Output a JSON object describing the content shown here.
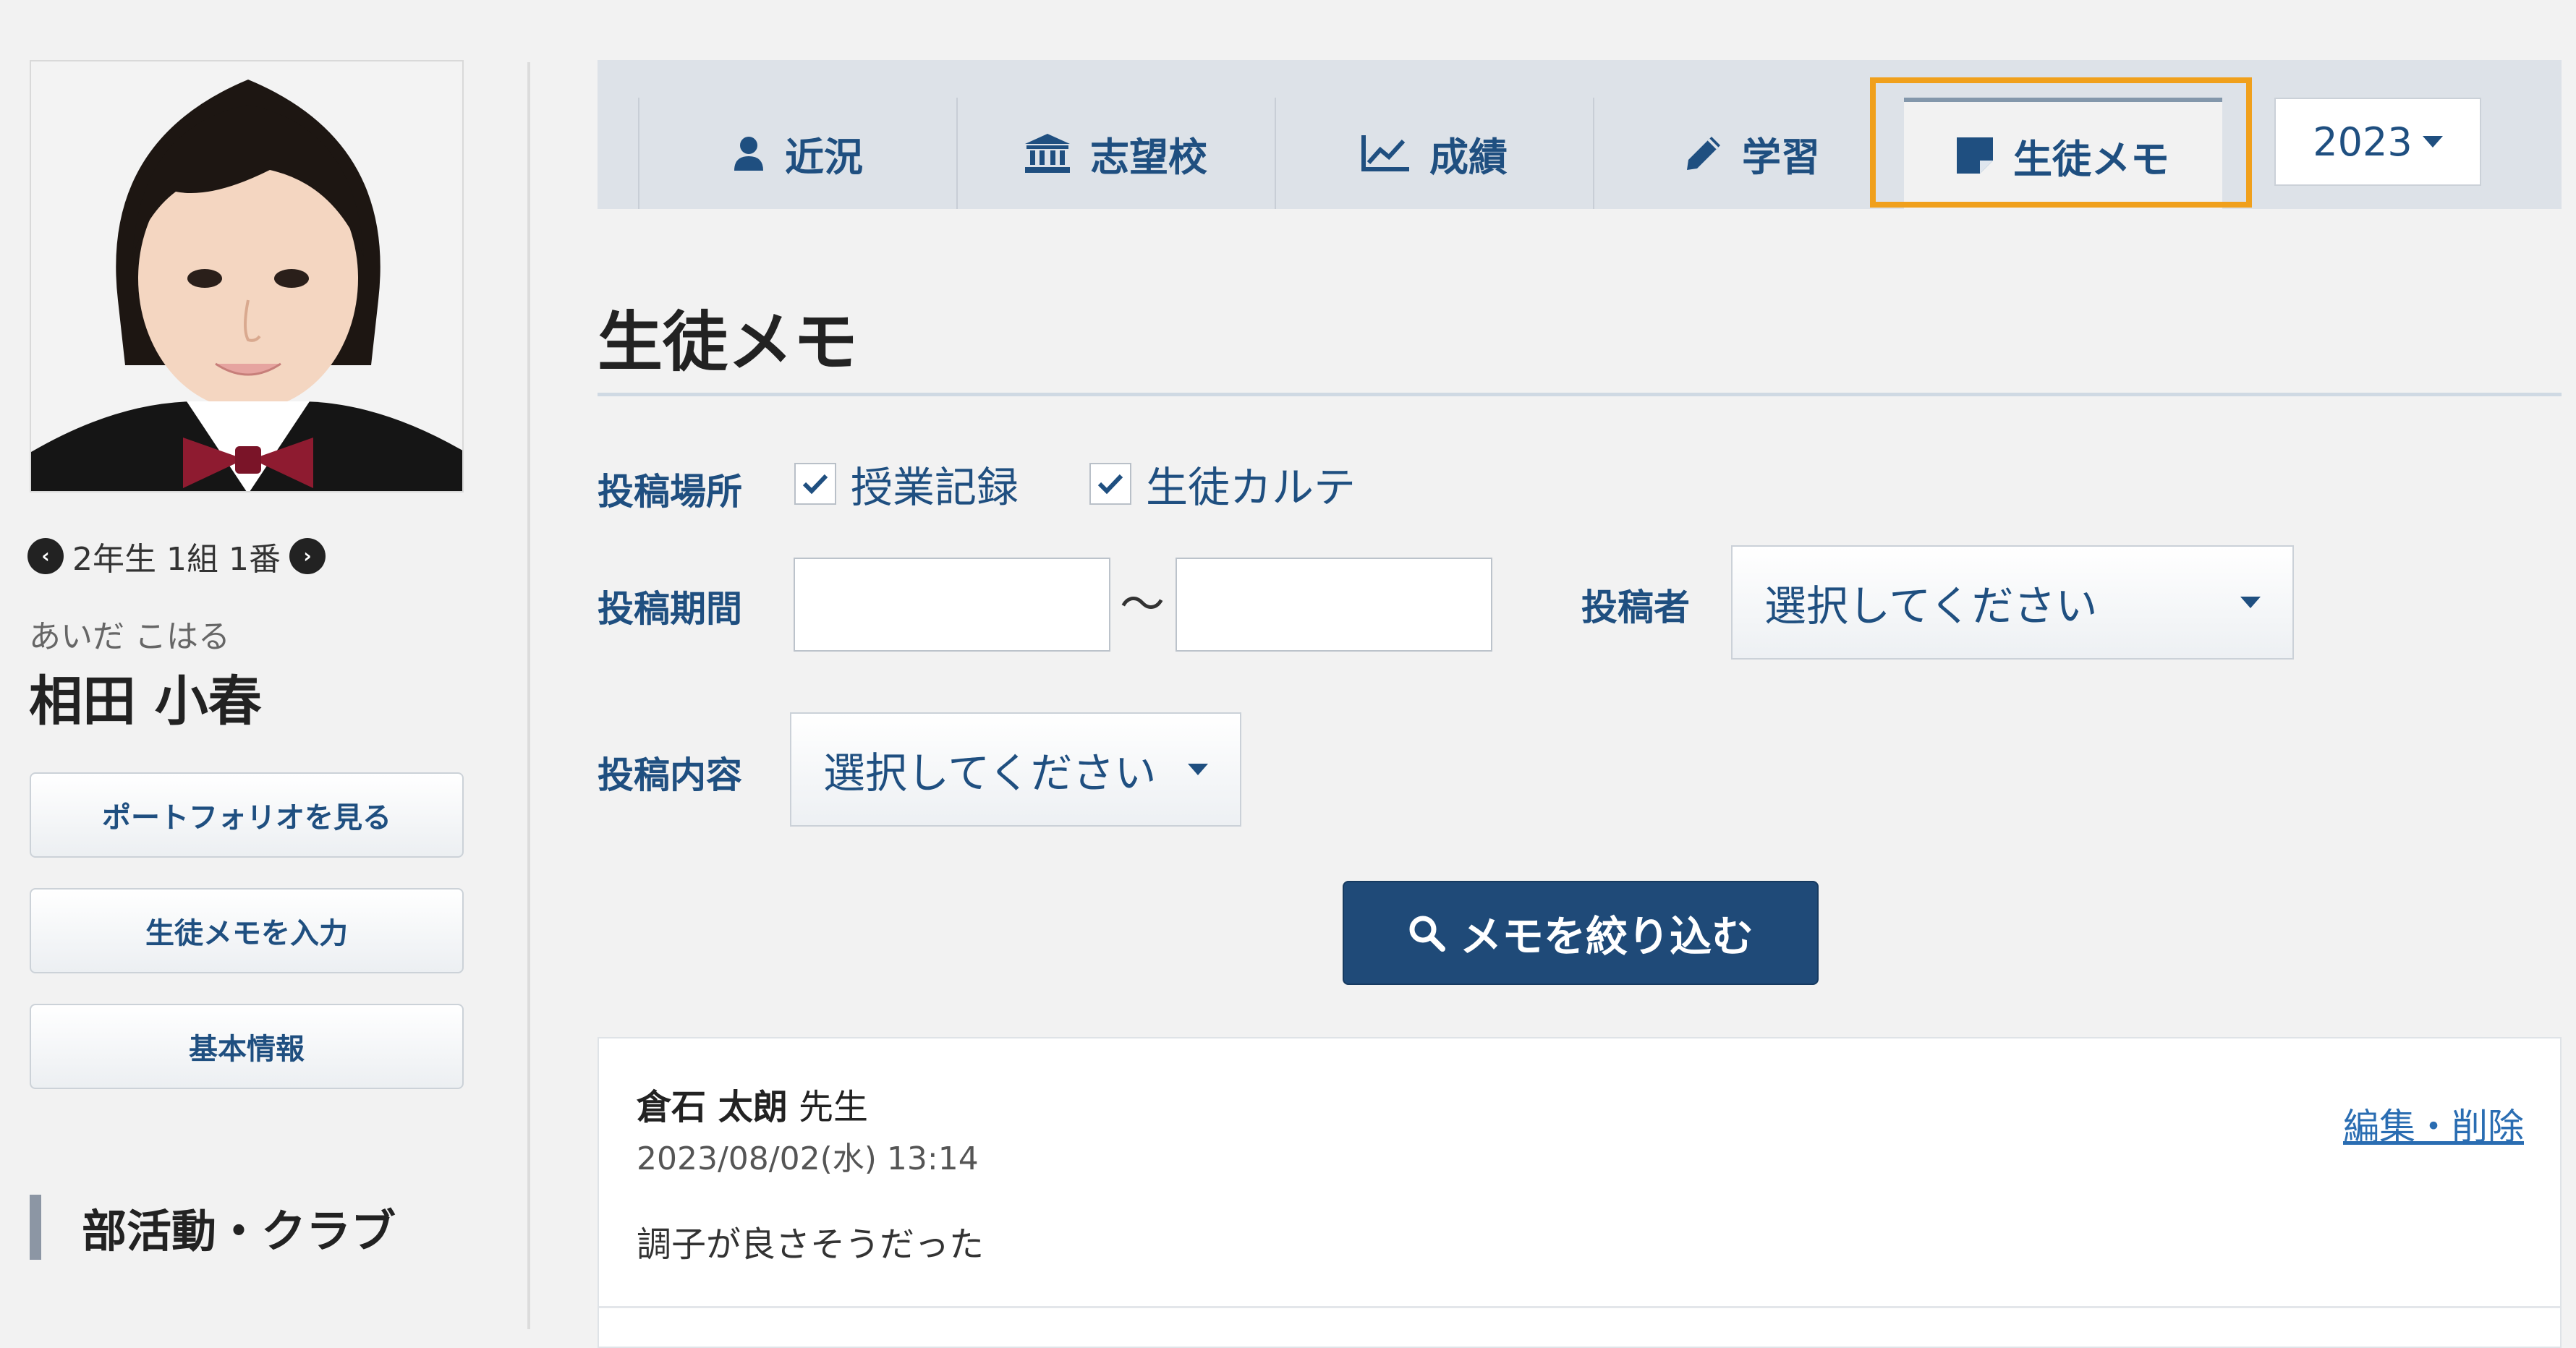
{
  "student": {
    "class_info": "2年生 1組 1番",
    "kana": "あいだ こはる",
    "name": "相田 小春"
  },
  "sidebar": {
    "buttons": [
      "ポートフォリオを見る",
      "生徒メモを入力",
      "基本情報"
    ],
    "section_title": "部活動・クラブ"
  },
  "tabs": [
    {
      "label": "近況",
      "icon": "user-icon"
    },
    {
      "label": "志望校",
      "icon": "university-icon"
    },
    {
      "label": "成績",
      "icon": "line-chart-icon"
    },
    {
      "label": "学習",
      "icon": "pencil-icon"
    },
    {
      "label": "生徒メモ",
      "icon": "sticky-note-icon",
      "active": true
    }
  ],
  "year_select": {
    "value": "2023"
  },
  "page_title": "生徒メモ",
  "filters": {
    "location_label": "投稿場所",
    "location_options": [
      {
        "label": "授業記録",
        "checked": true
      },
      {
        "label": "生徒カルテ",
        "checked": true
      }
    ],
    "period_label": "投稿期間",
    "period_from": "",
    "period_to": "",
    "period_separator": "～",
    "poster_label": "投稿者",
    "poster_value": "選択してください",
    "content_label": "投稿内容",
    "content_value": "選択してください",
    "submit_label": "メモを絞り込む"
  },
  "memo": {
    "author_name": "倉石 太朗",
    "author_suffix": "先生",
    "datetime": "2023/08/02(水) 13:14",
    "edit_label": "編集・削除",
    "body": "調子が良さそうだった"
  },
  "colors": {
    "accent": "#1f4f80",
    "button_primary": "#1f4a78",
    "highlight": "#f0a01c",
    "link": "#2a6db2"
  }
}
